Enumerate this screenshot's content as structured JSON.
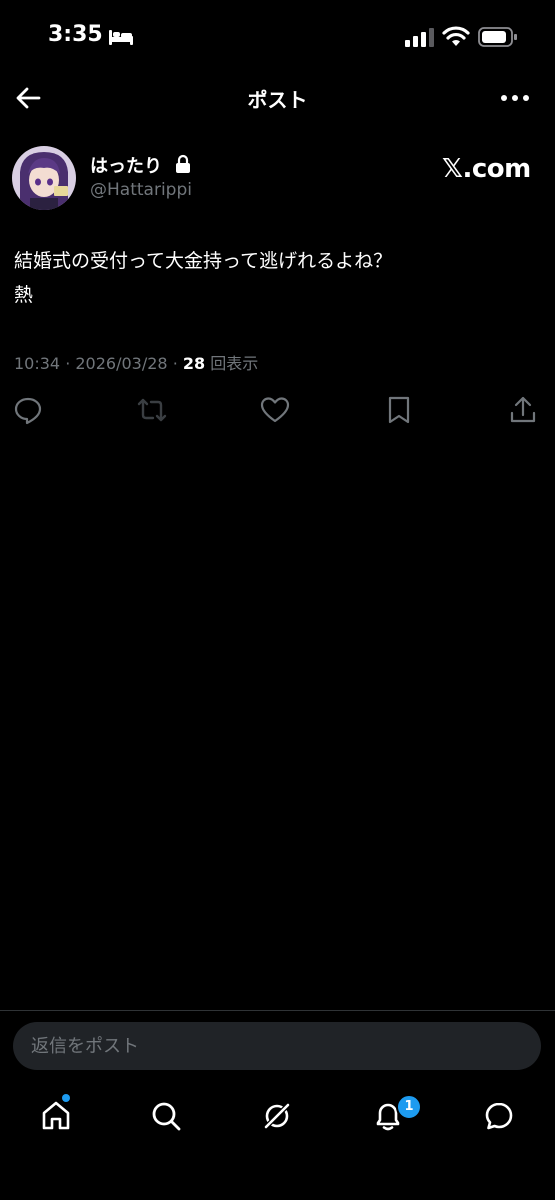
{
  "status_bar": {
    "time": "3:35"
  },
  "header": {
    "title": "ポスト"
  },
  "author": {
    "display_name": "はったり",
    "handle": "@Hattarippi"
  },
  "watermark": "𝕏.com",
  "post": {
    "text": "結婚式の受付って大金持って逃げれるよね？\n熱",
    "time": "10:34",
    "date": "2026/03/28",
    "views_count": "28",
    "views_label": "回表示"
  },
  "reply": {
    "placeholder": "返信をポスト"
  },
  "nav": {
    "notifications_badge": "1"
  },
  "colors": {
    "accent": "#1d9bf0",
    "muted": "#71767b",
    "background": "#000000"
  }
}
